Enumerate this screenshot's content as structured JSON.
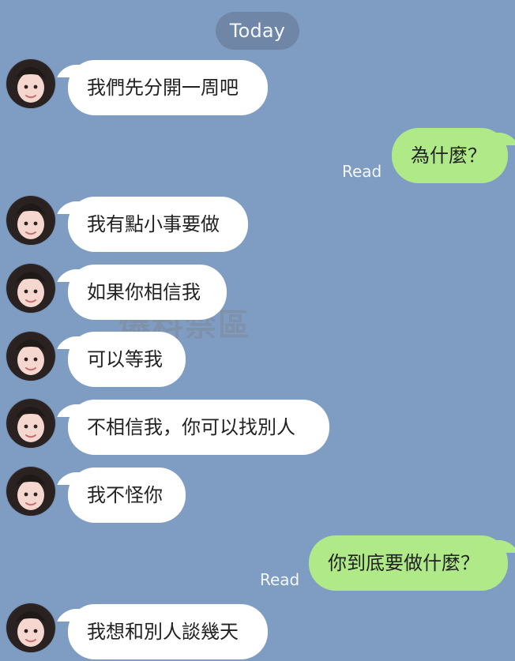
{
  "chat": {
    "date_label": "Today",
    "watermark": "爆料禁區",
    "messages": [
      {
        "side": "incoming",
        "text": "我們先分開一周吧"
      },
      {
        "side": "outgoing",
        "text": "為什麼？",
        "status": "Read"
      },
      {
        "side": "incoming",
        "text": "我有點小事要做"
      },
      {
        "side": "incoming",
        "text": "如果你相信我"
      },
      {
        "side": "incoming",
        "text": "可以等我"
      },
      {
        "side": "incoming",
        "text": "不相信我，你可以找別人"
      },
      {
        "side": "incoming",
        "text": "我不怪你"
      },
      {
        "side": "outgoing",
        "text": "你到底要做什麼？",
        "status": "Read"
      },
      {
        "side": "incoming",
        "text": "我想和別人談幾天"
      }
    ]
  },
  "colors": {
    "background": "#7f9cc3",
    "incoming_bubble": "#ffffff",
    "outgoing_bubble": "#b0ea88",
    "date_pill": "#6f86a6"
  },
  "icons": {
    "avatar": "avatar-photo-icon"
  }
}
